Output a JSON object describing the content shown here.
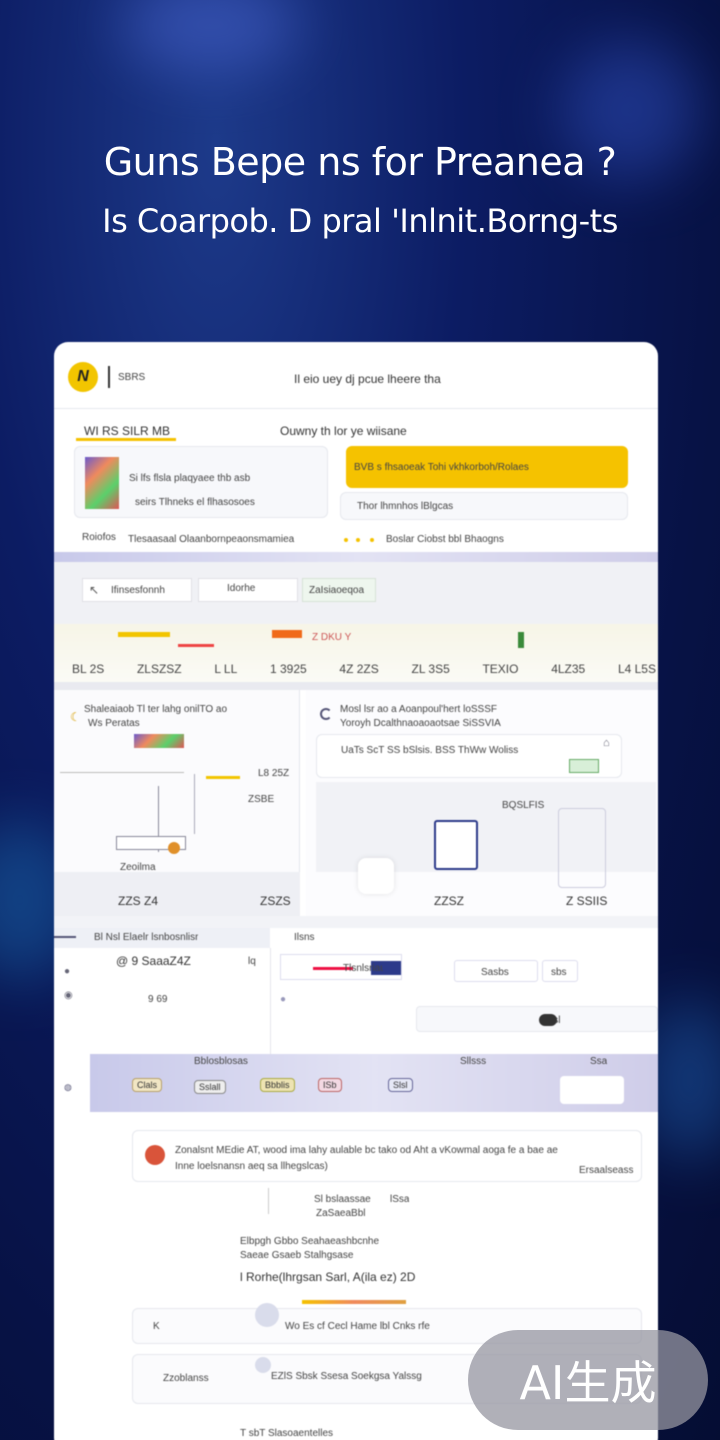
{
  "hero": {
    "line1": "Guns Bepe ns for Preanea ?",
    "line2": "Is Coarpob. D pral 'Inlnit.Borng-ts"
  },
  "header": {
    "logo_letter": "N",
    "brand_text": "SBRS",
    "title": "Il eio uey dj pcue lheere tha"
  },
  "section1": {
    "left_title": "WI RS SILR MB",
    "right_title": "Ouwny th lor ye wiisane",
    "item_line1": "Si lfs flsla plaqyaee thb asb",
    "item_line2": "seirs Tlhneks el flhasosoes",
    "yellow_text": "BVB s fhsaoeak Tohi vkhkorboh/Rolaes",
    "panel_text": "Thor lhmnhos lBlgcas",
    "footer_left": "Roiofos",
    "footer_mid": "Tlesaasaal Olaanbornpeaonsmamiea",
    "footer_right": "Boslar Ciobst bbl Bhaogns"
  },
  "toolbar": {
    "item1": "Ifinsesfonnh",
    "item2": "Idorhe",
    "item3": "ZaIsiaoeqoa"
  },
  "stats": {
    "top_label": "Z DKU Y",
    "values": [
      "BL 2S",
      "ZLSZSZ",
      "L LL",
      "1 3925",
      "4Z 2ZS",
      "ZL 3S5",
      "TEXIO",
      "4LZ35",
      "L4 L5S"
    ]
  },
  "section2": {
    "left_title": "Shaleaiaob Tl ter lahg onilTO ao",
    "left_sub": "Ws Peratas",
    "left_value1": "L8 25Z",
    "left_value2": "ZSBE",
    "left_small": "Zeoilma",
    "left_bottom": "ZZS Z4",
    "left_bottom2": "ZSZS",
    "right_title": "Mosl lsr ao a Aoanpoul'hert loSSSF",
    "right_sub": "Yoroyh Dcalthnaoaoaotsae SiSSVIA",
    "right_line": "UaTs ScT SS bSlsis. BSS ThWw Woliss",
    "right_small": "BQSLFIS",
    "right_bottom1": "ZZSZ",
    "right_bottom2": "Z SSIIS"
  },
  "section3": {
    "tab_title": "Bl Nsl Elaelr lsnbosnlisr",
    "tab2": "Ilsns",
    "code": "@ 9 SaaaZ4Z",
    "side_label": "lq",
    "value": "9 69",
    "btn_label": "Sasbs",
    "btn_label2": "sbs",
    "bar_label": "Tlsnlsriausmoos",
    "pill": "lsl",
    "strip_label": "Bblosblosas",
    "strip_label2": "Sllsss",
    "strip_label3": "Ssa",
    "chips": [
      "Clals",
      "Sslall",
      "Bbblis",
      "ISb",
      "Slsl"
    ]
  },
  "section4": {
    "alert_text": "Zonalsnt MEdie AT, wood ima lahy aulable bc tako od Aht a vKowmal aoga fe a bae ae",
    "alert_sub": "Inne loelsnansn aeq sa llhegslcas)",
    "alert_right": "Ersaalseass",
    "meta1": "Sl bslaassae",
    "meta1_value": "lSsa",
    "meta2": "ZaSaeaBbl",
    "info1": "Elbpgh Gbbo Seahaeashbcnhe",
    "info2": "Saeae Gsaeb Stalhgsase",
    "info_title": "l Rorhe(lhrgsan Sarl, A(ila ez) 2D",
    "row1": "Wo Es cf Cecl Hame lbl Cnks rfe",
    "row1_left": "K",
    "row2": "EZlS Sbsk Ssesa Soekgsa Yalssg",
    "row2_left": "Zzoblanss",
    "footer": "T sbT Slasoaentelles"
  },
  "badge": {
    "label": "AI生成"
  },
  "colors": {
    "accent": "#f5c200",
    "bg": "#0c1c63",
    "strip": "#c8c9ea"
  }
}
